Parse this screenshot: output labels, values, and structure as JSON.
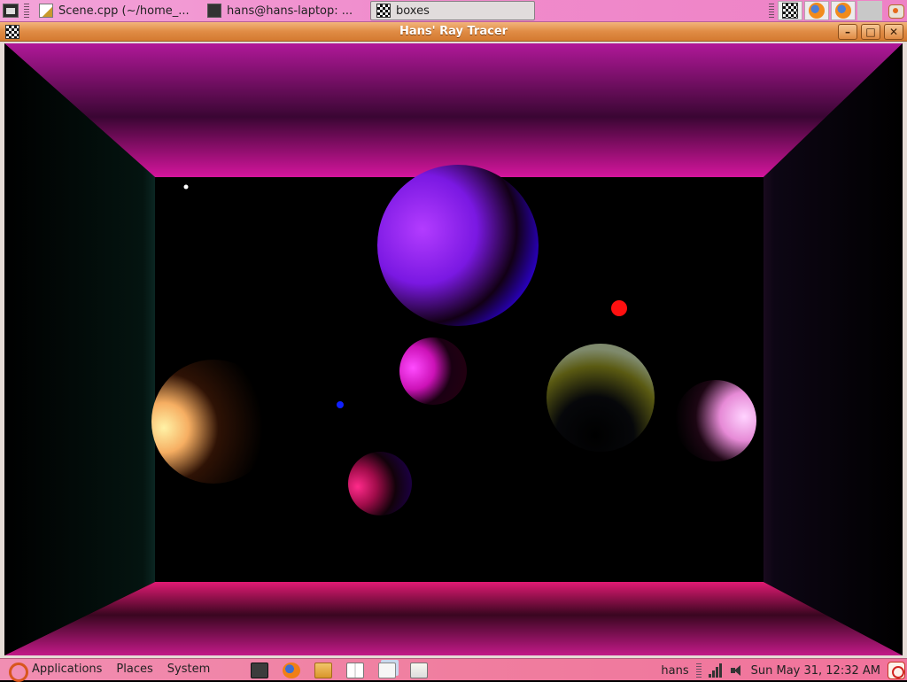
{
  "top_panel": {
    "tasks": [
      {
        "label": "Scene.cpp (~/home_...",
        "icon": "text-editor-icon",
        "active": false
      },
      {
        "label": "hans@hans-laptop: ...",
        "icon": "terminal-icon",
        "active": false
      },
      {
        "label": "boxes",
        "icon": "checker-icon",
        "active": true
      }
    ],
    "tray_icons": [
      "checker-icon",
      "firefox-icon",
      "firefox-icon",
      "blank-icon"
    ]
  },
  "window": {
    "title": "Hans' Ray Tracer",
    "buttons": {
      "minimize": "–",
      "maximize": "□",
      "close": "✕"
    }
  },
  "render": {
    "description_colors": {
      "ceiling": "#c2189c",
      "floor": "#e51a72",
      "walls": "#000000"
    }
  },
  "bottom_panel": {
    "menus": [
      "Applications",
      "Places",
      "System"
    ],
    "launchers": [
      "terminal-icon",
      "firefox-icon",
      "folder-icon",
      "help-book-icon",
      "windows-icon",
      "notes-icon"
    ],
    "user": "hans",
    "clock": "Sun May 31, 12:32 AM"
  }
}
